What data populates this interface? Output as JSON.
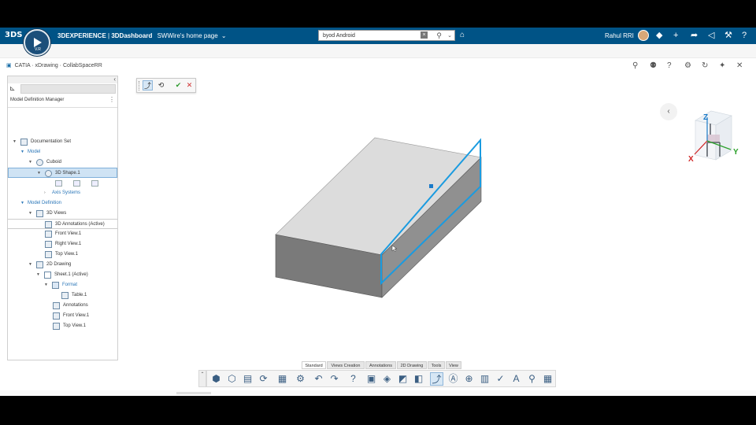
{
  "topbar": {
    "brand_prefix": "3DEXPERIENCE",
    "brand_sep": " | ",
    "brand_app": "3DDashboard",
    "dashboard_name": "SWWire's home page",
    "search_value": "byod Android",
    "user_name": "Rahul RRI",
    "compass_version": "V.R",
    "icons": [
      "ds-logo-icon",
      "compass-icon",
      "dropdown-chevron-icon",
      "search-clear-icon",
      "search-icon",
      "search-dropdown-icon",
      "tag-icon",
      "avatar",
      "notification-icon",
      "add-icon",
      "share-icon",
      "network-icon",
      "tools-icon",
      "help-icon"
    ]
  },
  "app": {
    "title": "CATIA · xDrawing · CollabSpaceRR",
    "header_icons": [
      "search-icon",
      "user-icon",
      "help-icon",
      "settings-icon",
      "refresh-icon",
      "pin-icon",
      "close-icon"
    ]
  },
  "tree": {
    "title": "Model Definition Manager",
    "rows": [
      {
        "label": "Documentation Set"
      },
      {
        "label": "Model"
      },
      {
        "label": "Cuboid"
      },
      {
        "label": "3D Shape.1"
      },
      {
        "label": "Axis Systems"
      },
      {
        "label": "Model Definition"
      },
      {
        "label": "3D Views"
      },
      {
        "label": "3D Annotations (Active)"
      },
      {
        "label": "Front View.1"
      },
      {
        "label": "Right View.1"
      },
      {
        "label": "Top View.1"
      },
      {
        "label": "2D Drawing"
      },
      {
        "label": "Sheet.1 (Active)"
      },
      {
        "label": "Format"
      },
      {
        "label": "Table.1"
      },
      {
        "label": "Annotations"
      },
      {
        "label": "Front View.1"
      },
      {
        "label": "Top View.1"
      }
    ]
  },
  "compass_axes": {
    "z": "Z",
    "x": "X",
    "y": "Y"
  },
  "colors": {
    "topbar_bg": "#005386",
    "selection": "#1a9be0",
    "box_top": "#dcdcdc",
    "box_front": "#7a7a7a",
    "box_side": "#909090",
    "axis_z": "#1a7ac8",
    "axis_x": "#d02525",
    "axis_y": "#2aa02a"
  },
  "bottom_tabs": [
    "Standard",
    "Views Creation",
    "Annotations",
    "2D Drawing",
    "Tools",
    "View"
  ],
  "active_tab": "Standard",
  "toolbar_icons": [
    "new-icon",
    "open-icon",
    "save-icon",
    "refresh-icon",
    "properties-icon",
    "settings-icon",
    "undo-icon",
    "redo-icon",
    "help-icon",
    "front-view-icon",
    "iso-view-icon",
    "section-view-icon",
    "detail-view-icon",
    "select-icon",
    "text-icon",
    "magnify-icon",
    "dimension-icon",
    "check-icon",
    "font-icon",
    "zoom-icon",
    "table-icon"
  ]
}
